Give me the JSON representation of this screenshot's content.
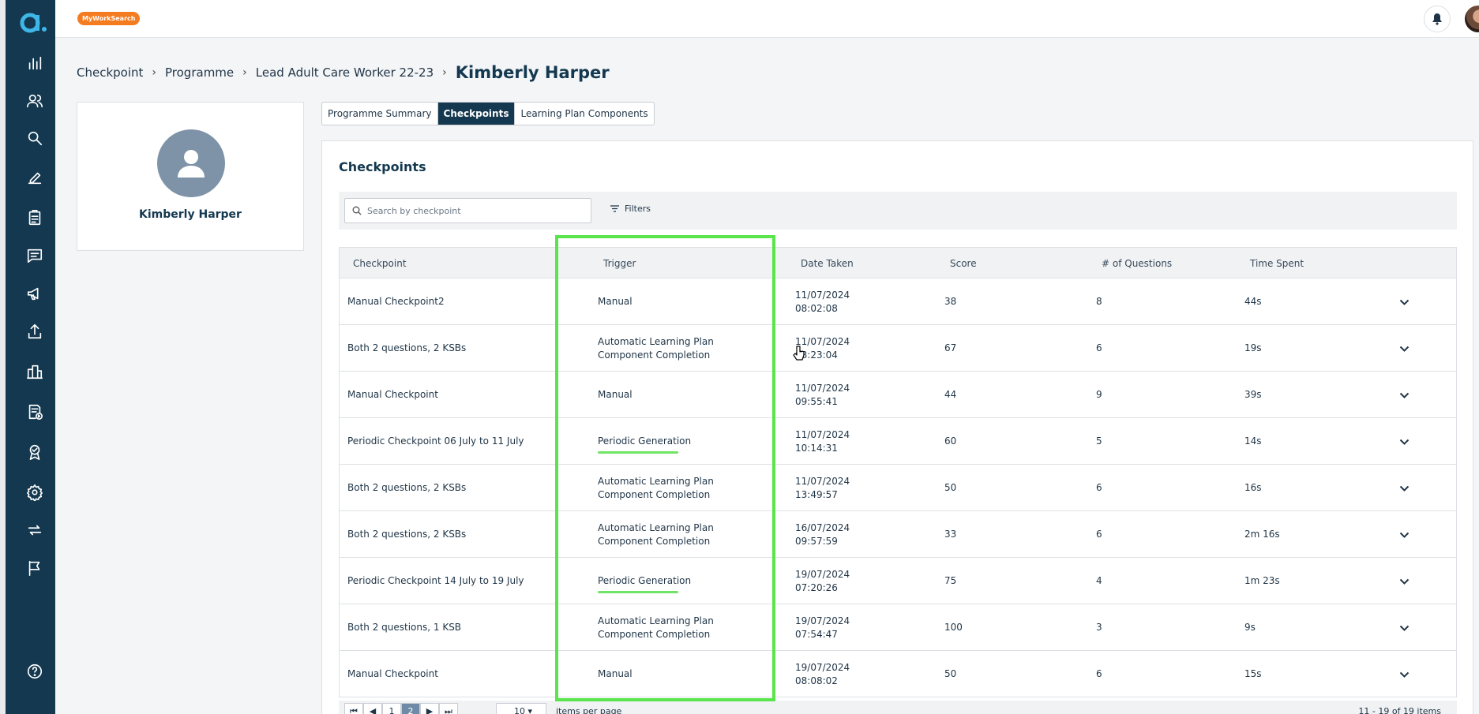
{
  "app": {
    "badge": "MyWorkSearch",
    "accent": "#13384f",
    "highlight_color": "#59e54b"
  },
  "sidebar": {
    "icons": [
      "logo-icon",
      "chart-icon",
      "users-icon",
      "search-icon",
      "pen-icon",
      "clipboard-icon",
      "chat-icon",
      "megaphone-icon",
      "upload-icon",
      "report-icon",
      "document-play-icon",
      "badge-icon",
      "gear-icon",
      "sync-icon",
      "flag-icon",
      "help-icon"
    ]
  },
  "breadcrumb": {
    "items": [
      "Checkpoint",
      "Programme",
      "Lead Adult Care Worker 22-23"
    ],
    "current": "Kimberly Harper"
  },
  "profile": {
    "name": "Kimberly Harper"
  },
  "tabs": [
    {
      "label": "Programme Summary",
      "active": false
    },
    {
      "label": "Checkpoints",
      "active": true
    },
    {
      "label": "Learning Plan Components",
      "active": false
    }
  ],
  "panel": {
    "title": "Checkpoints",
    "search_placeholder": "Search by checkpoint",
    "filters_label": "Filters"
  },
  "table": {
    "headers": {
      "checkpoint": "Checkpoint",
      "trigger": "Trigger",
      "date": "Date Taken",
      "score": "Score",
      "questions": "# of Questions",
      "time": "Time Spent"
    },
    "rows": [
      {
        "name": "Manual Checkpoint2",
        "trigger": "Manual",
        "date1": "11/07/2024",
        "date2": "08:02:08",
        "score": "38",
        "questions": "8",
        "time": "44s"
      },
      {
        "name": "Both 2 questions, 2 KSBs",
        "trigger": "Automatic Learning Plan Component Completion",
        "date1": "11/07/2024",
        "date2": "08:23:04",
        "score": "67",
        "questions": "6",
        "time": "19s"
      },
      {
        "name": "Manual Checkpoint",
        "trigger": "Manual",
        "date1": "11/07/2024",
        "date2": "09:55:41",
        "score": "44",
        "questions": "9",
        "time": "39s"
      },
      {
        "name": "Periodic Checkpoint 06 July to 11 July",
        "trigger": "Periodic Generation",
        "date1": "11/07/2024",
        "date2": "10:14:31",
        "score": "60",
        "questions": "5",
        "time": "14s"
      },
      {
        "name": "Both 2 questions, 2 KSBs",
        "trigger": "Automatic Learning Plan Component Completion",
        "date1": "11/07/2024",
        "date2": "13:49:57",
        "score": "50",
        "questions": "6",
        "time": "16s"
      },
      {
        "name": "Both 2 questions, 2 KSBs",
        "trigger": "Automatic Learning Plan Component Completion",
        "date1": "16/07/2024",
        "date2": "09:57:59",
        "score": "33",
        "questions": "6",
        "time": "2m 16s"
      },
      {
        "name": "Periodic Checkpoint 14 July to 19 July",
        "trigger": "Periodic Generation",
        "date1": "19/07/2024",
        "date2": "07:20:26",
        "score": "75",
        "questions": "4",
        "time": "1m 23s"
      },
      {
        "name": "Both 2 questions, 1 KSB",
        "trigger": "Automatic Learning Plan Component Completion",
        "date1": "19/07/2024",
        "date2": "07:54:47",
        "score": "100",
        "questions": "3",
        "time": "9s"
      },
      {
        "name": "Manual Checkpoint",
        "trigger": "Manual",
        "date1": "19/07/2024",
        "date2": "08:08:02",
        "score": "50",
        "questions": "6",
        "time": "15s"
      }
    ]
  },
  "pager": {
    "first": "⏮",
    "prev": "◀",
    "pages": [
      "1",
      "2"
    ],
    "current_page": "2",
    "next": "▶",
    "last": "⏭",
    "page_size": "10",
    "per_page_label": "items per page",
    "info": "11 - 19 of 19 items"
  }
}
